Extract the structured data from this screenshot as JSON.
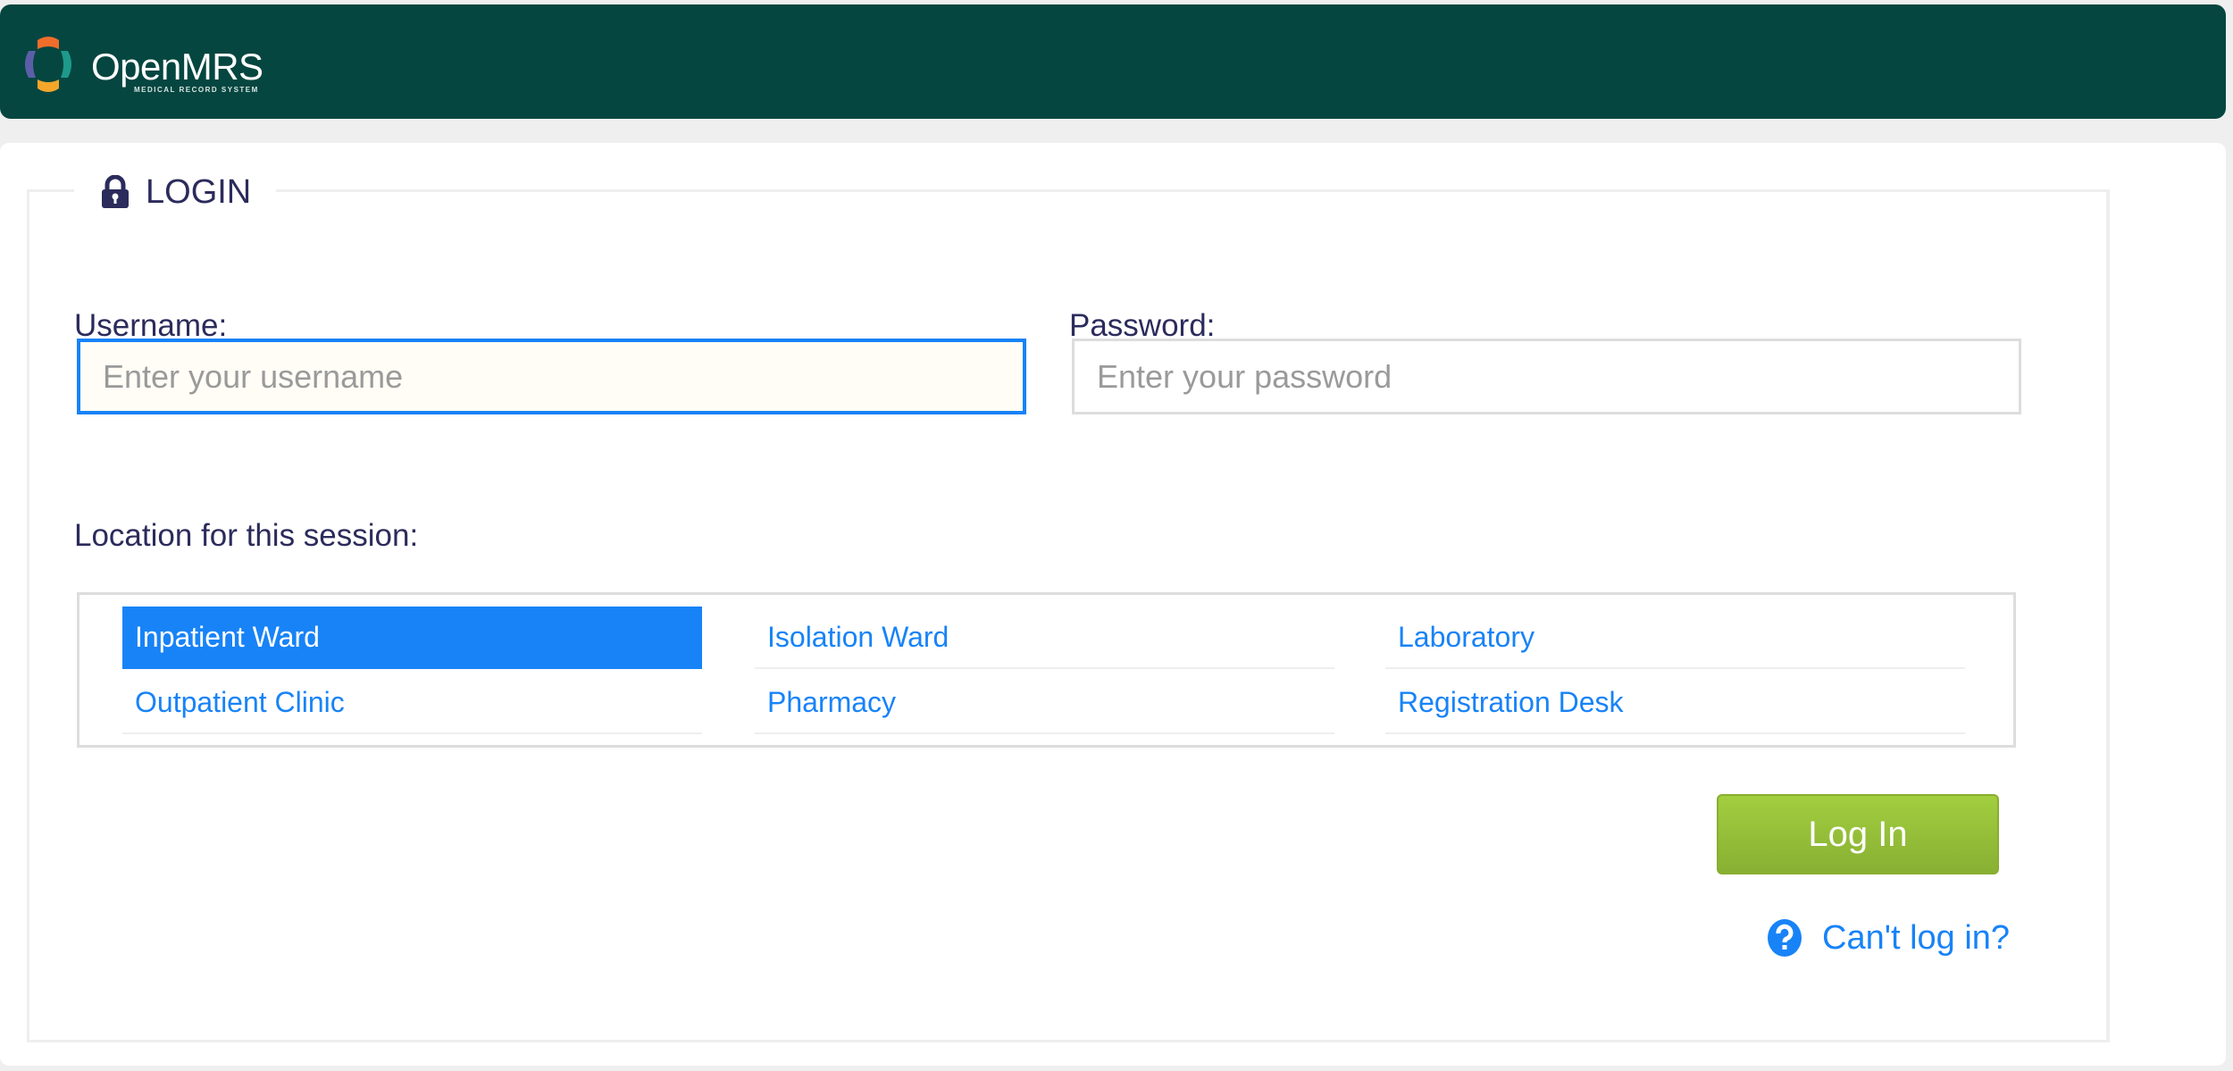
{
  "header": {
    "brand": "OpenMRS",
    "tagline": "MEDICAL RECORD SYSTEM",
    "logo_colors": [
      "#f06d2b",
      "#1d9a8a",
      "#f4a62a",
      "#5c5fa8"
    ],
    "background": "#064640"
  },
  "login": {
    "title": "LOGIN",
    "title_icon": "lock-icon",
    "username_label": "Username:",
    "username_placeholder": "Enter your username",
    "username_value": "",
    "password_label": "Password:",
    "password_placeholder": "Enter your password",
    "password_value": "",
    "location_label": "Location for this session:",
    "locations": [
      {
        "label": "Inpatient Ward",
        "selected": true
      },
      {
        "label": "Isolation Ward",
        "selected": false
      },
      {
        "label": "Laboratory",
        "selected": false
      },
      {
        "label": "Outpatient Clinic",
        "selected": false
      },
      {
        "label": "Pharmacy",
        "selected": false
      },
      {
        "label": "Registration Desk",
        "selected": false
      }
    ],
    "submit_label": "Log In",
    "help_icon": "question-circle-icon",
    "help_link": "Can't log in?",
    "accent_color": "#1883f7",
    "button_color": "#94bd37"
  }
}
